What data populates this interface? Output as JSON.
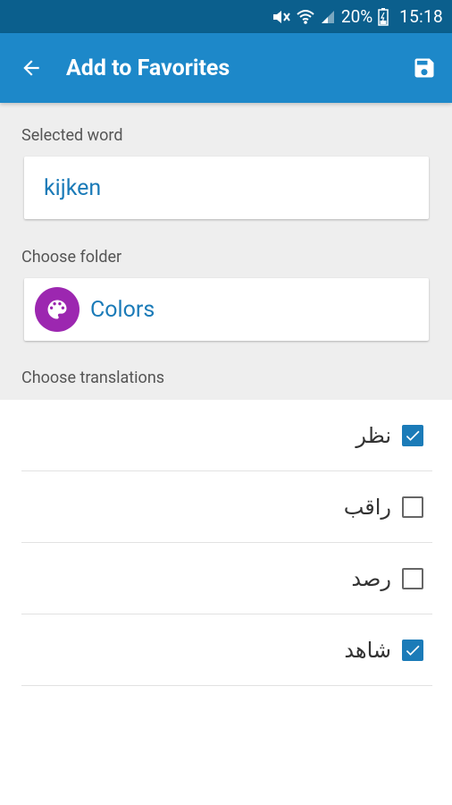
{
  "status_bar": {
    "battery": "20%",
    "time": "15:18",
    "icons": [
      "mute-icon",
      "wifi-icon",
      "signal-icon",
      "battery-icon"
    ]
  },
  "app_bar": {
    "title": "Add to Favorites",
    "back_icon": "arrow-back-icon",
    "save_icon": "save-icon",
    "color": "#1d88c9"
  },
  "form": {
    "selected_word_label": "Selected word",
    "selected_word": "kijken",
    "choose_folder_label": "Choose folder",
    "folder": {
      "name": "Colors",
      "icon": "palette-icon",
      "icon_color": "#9c27b0"
    },
    "choose_translations_label": "Choose translations"
  },
  "translations": [
    {
      "text": "نظر",
      "checked": true
    },
    {
      "text": "راقب",
      "checked": false
    },
    {
      "text": "رصد",
      "checked": false
    },
    {
      "text": "شاهد",
      "checked": true
    }
  ]
}
